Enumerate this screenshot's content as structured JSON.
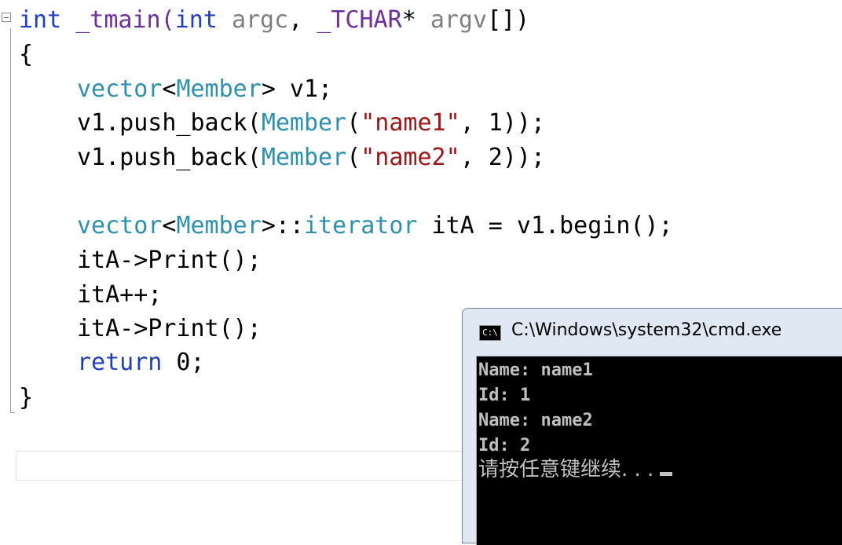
{
  "code": {
    "line1": {
      "t1": "int",
      "t2": " _tmain(",
      "t3": "int",
      "t4": " ",
      "t5": "argc",
      "t6": ", ",
      "t7": "_TCHAR",
      "t8": "* ",
      "t9": "argv",
      "t10": "[])"
    },
    "line2": "{",
    "line3": {
      "t1": "vector",
      "t2": "<",
      "t3": "Member",
      "t4": "> v1;"
    },
    "line4": {
      "t1": "v1.push_back(",
      "t2": "Member",
      "t3": "(",
      "t4": "\"name1\"",
      "t5": ", 1));"
    },
    "line5": {
      "t1": "v1.push_back(",
      "t2": "Member",
      "t3": "(",
      "t4": "\"name2\"",
      "t5": ", 2));"
    },
    "line7": {
      "t1": "vector",
      "t2": "<",
      "t3": "Member",
      "t4": ">::",
      "t5": "iterator",
      "t6": " itA = v1.begin();"
    },
    "line8": "itA->Print();",
    "line9": "itA++;",
    "line10": "itA->Print();",
    "line11": {
      "t1": "return",
      "t2": " 0;"
    },
    "line12": "}"
  },
  "cmd": {
    "title": "C:\\Windows\\system32\\cmd.exe",
    "icon_label": "C:\\",
    "icon": "console-icon",
    "lines": [
      "Name: name1",
      "Id: 1",
      "Name: name2",
      "Id: 2"
    ],
    "prompt": "请按任意键继续. . ."
  },
  "colors": {
    "keyword": "#1f3fc6",
    "type": "#2b91af",
    "string": "#a31515",
    "parameter": "#7f7f7f",
    "console_bg": "#000000",
    "console_text": "#c0c0c0"
  }
}
